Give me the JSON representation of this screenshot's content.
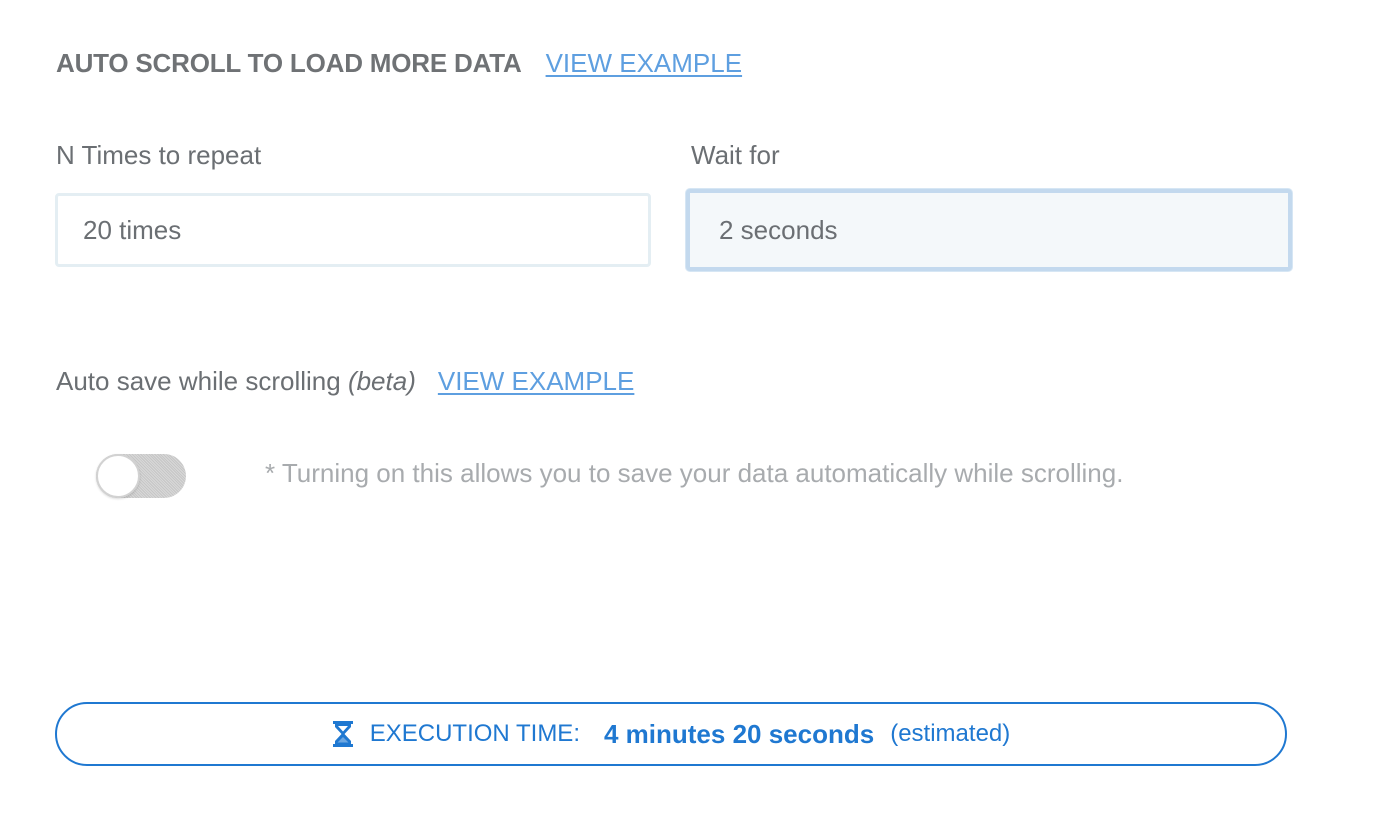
{
  "auto_scroll": {
    "title": "AUTO SCROLL TO LOAD MORE DATA",
    "view_example": "VIEW EXAMPLE"
  },
  "repeat": {
    "label": "N Times to repeat",
    "value": "20 times"
  },
  "wait": {
    "label": "Wait for",
    "value": "2 seconds"
  },
  "auto_save": {
    "label": "Auto save while scrolling",
    "beta": "(beta)",
    "view_example": "VIEW EXAMPLE",
    "enabled": false,
    "hint": "* Turning on this allows you to save your data automatically while scrolling."
  },
  "execution": {
    "label": "EXECUTION TIME:",
    "value": "4 minutes 20 seconds",
    "suffix": "(estimated)",
    "icon": "hourglass-icon"
  },
  "colors": {
    "accent": "#1f78d1",
    "link": "#5e9fe0",
    "text": "#6b6f73",
    "hint": "#a8abae"
  }
}
